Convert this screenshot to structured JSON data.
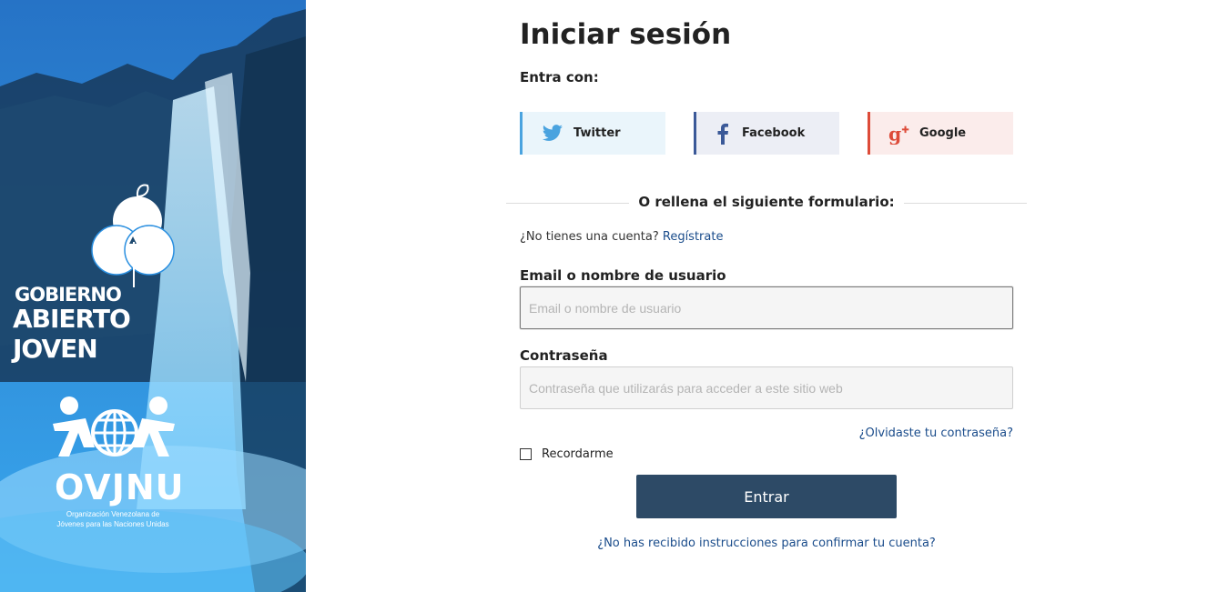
{
  "side": {
    "logo_gaj": {
      "line1": "GOBIERNO",
      "line2": "ABIERTO JOVEN"
    },
    "logo_ovjnu": {
      "name": "OVJNU",
      "subtitle_line1": "Organización Venezolana de",
      "subtitle_line2": "Jóvenes para las Naciones Unidas"
    }
  },
  "main": {
    "title": "Iniciar sesión",
    "enter_with": "Entra con:",
    "social": [
      {
        "label": "Twitter",
        "icon": "twitter-icon",
        "color": "#4aa3df"
      },
      {
        "label": "Facebook",
        "icon": "facebook-icon",
        "color": "#3b5998"
      },
      {
        "label": "Google",
        "icon": "google-plus-icon",
        "color": "#dd4b39"
      }
    ],
    "divider": "O rellena el siguiente formulario:",
    "no_account": "¿No tienes una cuenta?",
    "register_link": "Regístrate",
    "email_label": "Email o nombre de usuario",
    "email_placeholder": "Email o nombre de usuario",
    "email_value": "",
    "password_label": "Contraseña",
    "password_placeholder": "Contraseña que utilizarás para acceder a este sitio web",
    "password_value": "",
    "forgot_link": "¿Olvidaste tu contraseña?",
    "remember_label": "Recordarme",
    "remember_checked": false,
    "submit_label": "Entrar",
    "confirm_link": "¿No has recibido instrucciones para confirmar tu cuenta?"
  },
  "colors": {
    "primary_button": "#2d4a66",
    "link": "#1a4c8b",
    "panel_blue": "#2a8fe0"
  }
}
